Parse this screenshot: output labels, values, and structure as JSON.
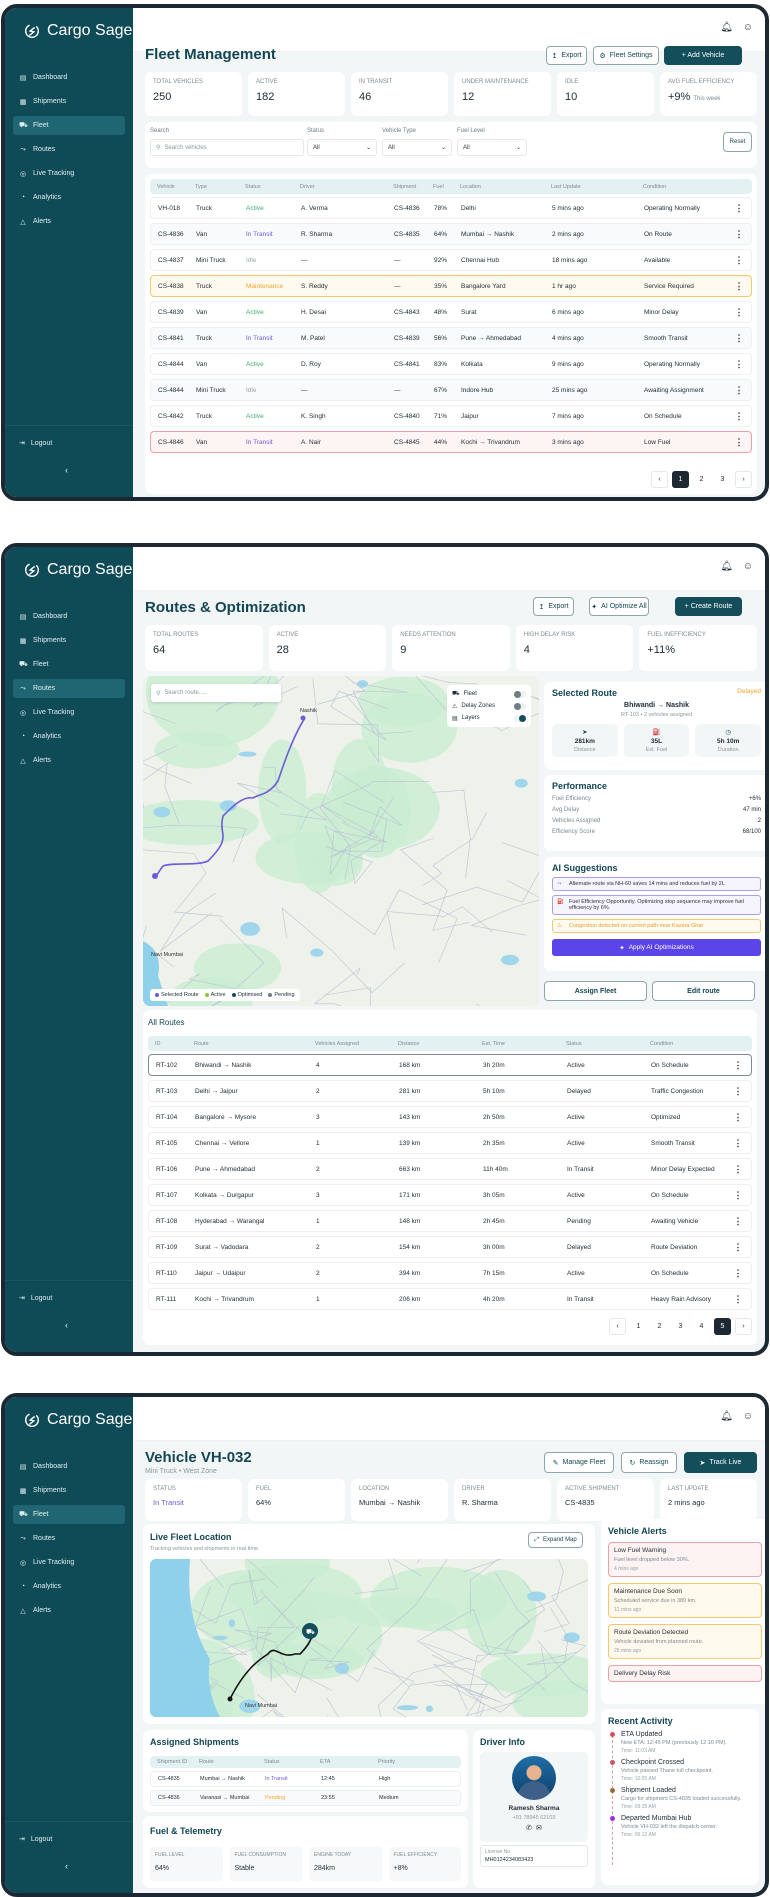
{
  "app": {
    "name": "Cargo Sage"
  },
  "sidebar": {
    "items": [
      {
        "label": "Dashboard",
        "icon": "dashboard-icon"
      },
      {
        "label": "Shipments",
        "icon": "shipments-icon"
      },
      {
        "label": "Fleet",
        "icon": "truck-icon"
      },
      {
        "label": "Routes",
        "icon": "route-icon"
      },
      {
        "label": "Live Tracking",
        "icon": "location-icon"
      },
      {
        "label": "Analytics",
        "icon": "analytics-icon"
      },
      {
        "label": "Alerts",
        "icon": "alert-icon"
      }
    ],
    "logout": "Logout"
  },
  "fleet": {
    "title": "Fleet Management",
    "buttons": {
      "export": "Export",
      "settings": "Fleet Settings",
      "add": "+ Add Vehicle"
    },
    "stats": [
      {
        "label": "Total Vehicles",
        "value": "250"
      },
      {
        "label": "Active",
        "value": "182"
      },
      {
        "label": "In Transit",
        "value": "46"
      },
      {
        "label": "Under Maintenance",
        "value": "12"
      },
      {
        "label": "Idle",
        "value": "10"
      },
      {
        "label": "Avg Fuel Efficiency",
        "value": "+9%",
        "note": "This week"
      }
    ],
    "filters": {
      "search_label": "Search",
      "search_placeholder": "Search vehicles",
      "status_label": "Status",
      "status_value": "All",
      "type_label": "Vehicle Type",
      "type_value": "All",
      "fuel_label": "Fuel Level",
      "fuel_value": "All",
      "reset": "Reset"
    },
    "columns": [
      "Vehicle",
      "Type",
      "Status",
      "Driver",
      "Shipment",
      "Fuel",
      "Location",
      "Last Update",
      "Condition"
    ],
    "rows": [
      [
        "VH-018",
        "Truck",
        "Active",
        "A. Verma",
        "CS-4836",
        "78%",
        "Delhi",
        "5 mins ago",
        "Operating Normally"
      ],
      [
        "CS-4836",
        "Van",
        "In Transit",
        "R. Sharma",
        "CS-4835",
        "64%",
        "Mumbai → Nashik",
        "2 mins ago",
        "On Route"
      ],
      [
        "CS-4837",
        "Mini Truck",
        "Idle",
        "—",
        "—",
        "92%",
        "Chennai Hub",
        "18 mins ago",
        "Available"
      ],
      [
        "CS-4838",
        "Truck",
        "Maintenance",
        "S. Reddy",
        "—",
        "35%",
        "Bangalore Yard",
        "1 hr ago",
        "Service Required"
      ],
      [
        "CS-4839",
        "Van",
        "Active",
        "H. Desai",
        "CS-4843",
        "48%",
        "Surat",
        "6 mins ago",
        "Minor Delay"
      ],
      [
        "CS-4841",
        "Truck",
        "In Transit",
        "M. Patel",
        "CS-4839",
        "56%",
        "Pune → Ahmedabad",
        "4 mins ago",
        "Smooth Transit"
      ],
      [
        "CS-4844",
        "Van",
        "Active",
        "D. Roy",
        "CS-4841",
        "83%",
        "Kolkata",
        "9 mins ago",
        "Operating Normally"
      ],
      [
        "CS-4844",
        "Mini Truck",
        "Idle",
        "—",
        "—",
        "67%",
        "Indore Hub",
        "25 mins ago",
        "Awaiting Assignment"
      ],
      [
        "CS-4842",
        "Truck",
        "Active",
        "K. Singh",
        "CS-4840",
        "71%",
        "Jaipur",
        "7 mins ago",
        "On Schedule"
      ],
      [
        "CS-4846",
        "Van",
        "In Transit",
        "A. Nair",
        "CS-4845",
        "44%",
        "Kochi → Trivandrum",
        "3 mins ago",
        "Low Fuel"
      ]
    ],
    "pages": [
      "1",
      "2",
      "3"
    ],
    "current_page": "1"
  },
  "routes": {
    "title": "Routes & Optimization",
    "buttons": {
      "export": "Export",
      "optimize": "AI Optimize All",
      "create": "+ Create Route"
    },
    "stats": [
      {
        "label": "Total Routes",
        "value": "64"
      },
      {
        "label": "Active",
        "value": "28"
      },
      {
        "label": "Needs Attention",
        "value": "9"
      },
      {
        "label": "High Delay Risk",
        "value": "4"
      },
      {
        "label": "Fuel Inefficiency",
        "value": "+11%"
      }
    ],
    "map": {
      "search_placeholder": "Search route.....",
      "layers": [
        {
          "label": "Fleet",
          "on": false
        },
        {
          "label": "Delay Zones",
          "on": false
        },
        {
          "label": "Layers",
          "on": true
        }
      ],
      "places": [
        "Nashik",
        "Navi Mumbai"
      ],
      "legend": [
        {
          "label": "Selected Route",
          "color": "#6e5bd9"
        },
        {
          "label": "Active",
          "color": "#8cc63f"
        },
        {
          "label": "Optimised",
          "color": "#134e5a"
        },
        {
          "label": "Pending",
          "color": "#6f7d83"
        }
      ]
    },
    "selected": {
      "heading": "Selected Route",
      "status": "Delayed",
      "route": "Bhiwandi → Nashik",
      "meta": "RT-103 • 2 vehicles assigned",
      "metrics": [
        {
          "value": "281km",
          "label": "Distance"
        },
        {
          "value": "35L",
          "label": "Est. Fuel"
        },
        {
          "value": "5h 10m",
          "label": "Duration"
        }
      ]
    },
    "performance": {
      "heading": "Performance",
      "items": [
        {
          "k": "Fuel Efficiency",
          "v": "+6%"
        },
        {
          "k": "Avg Delay",
          "v": "47 min"
        },
        {
          "k": "Vehicles Assigned",
          "v": "2"
        },
        {
          "k": "Efficiency Score",
          "v": "68/100"
        }
      ]
    },
    "ai": {
      "heading": "AI Suggestions",
      "items": [
        "Alternate route via NH-60 saves 14 mins and reduces fuel by 2L",
        "Fuel Efficiency Opportunity. Optimizing stop sequence may improve fuel efficiency by 6%."
      ],
      "warning": "Congestion detected on current path near Kasara Ghat",
      "apply": "Apply AI Optimizations"
    },
    "actions": {
      "assign": "Assign Fleet",
      "edit": "Edit route"
    },
    "all_title": "All Routes",
    "columns": [
      "ID",
      "Route",
      "Vehicles Assigned",
      "Distance",
      "Est. Time",
      "Status",
      "Condition"
    ],
    "rows": [
      [
        "RT-102",
        "Bhiwandi → Nashik",
        "4",
        "168 km",
        "3h 20m",
        "Active",
        "On Schedule"
      ],
      [
        "RT-103",
        "Delhi → Jaipur",
        "2",
        "281 km",
        "5h 10m",
        "Delayed",
        "Traffic Congestion"
      ],
      [
        "RT-104",
        "Bangalore → Mysore",
        "3",
        "143 km",
        "2h 50m",
        "Active",
        "Optimized"
      ],
      [
        "RT-105",
        "Chennai → Vellore",
        "1",
        "139 km",
        "2h 35m",
        "Active",
        "Smooth Transit"
      ],
      [
        "RT-106",
        "Pune → Ahmedabad",
        "2",
        "663 km",
        "11h 40m",
        "In Transit",
        "Minor Delay Expected"
      ],
      [
        "RT-107",
        "Kolkata → Durgapur",
        "3",
        "171 km",
        "3h 05m",
        "Active",
        "On Schedule"
      ],
      [
        "RT-108",
        "Hyderabad → Warangal",
        "1",
        "148 km",
        "2h 45m",
        "Pending",
        "Awaiting Vehicle"
      ],
      [
        "RT-109",
        "Surat → Vadodara",
        "2",
        "154 km",
        "3h 00m",
        "Delayed",
        "Route Deviation"
      ],
      [
        "RT-110",
        "Jaipur → Udaipur",
        "2",
        "394 km",
        "7h 15m",
        "Active",
        "On Schedule"
      ],
      [
        "RT-111",
        "Kochi → Trivandrum",
        "1",
        "206 km",
        "4h 20m",
        "In Transit",
        "Heavy Rain Advisory"
      ]
    ],
    "pages": [
      "1",
      "2",
      "3",
      "4",
      "5"
    ],
    "current_page": "5"
  },
  "vehicle": {
    "title": "Vehicle VH-032",
    "subtitle": "Mini Truck • West Zone",
    "buttons": {
      "manage": "Manage Fleet",
      "reassign": "Reassign",
      "track": "Track Live"
    },
    "stats": [
      {
        "label": "Status",
        "value": "In Transit"
      },
      {
        "label": "Fuel",
        "value": "64%"
      },
      {
        "label": "Location",
        "value": "Mumbai → Nashik"
      },
      {
        "label": "Driver",
        "value": "R. Sharma"
      },
      {
        "label": "Active Shipment",
        "value": "CS-4835"
      },
      {
        "label": "Last Update",
        "value": "2 mins ago"
      }
    ],
    "live": {
      "title": "Live Fleet Location",
      "subtitle": "Tracking vehicles and shipments in real time.",
      "expand": "Expand Map",
      "places": [
        "Navi Mumbai"
      ]
    },
    "shipments": {
      "title": "Assigned Shipments",
      "columns": [
        "Shipment ID",
        "Route",
        "Status",
        "ETA",
        "Priority"
      ],
      "rows": [
        [
          "CS-4835",
          "Mumbai → Nashik",
          "In Transit",
          "12:45",
          "High"
        ],
        [
          "CS-4836",
          "Varanasi → Mumbai",
          "Pending",
          "23:55",
          "Medium"
        ]
      ]
    },
    "fuel": {
      "title": "Fuel & Telemetry",
      "items": [
        {
          "label": "Fuel Level",
          "value": "64%"
        },
        {
          "label": "Fuel Consumption",
          "value": "Stable"
        },
        {
          "label": "Engine Today",
          "value": "284km"
        },
        {
          "label": "Fuel Efficiency",
          "value": "+8%"
        }
      ]
    },
    "driver": {
      "title": "Driver Info",
      "name": "Ramesh Sharma",
      "phone": "+91 78945 62103",
      "license_label": "License No.",
      "license": "MH0124234083423"
    },
    "alerts": {
      "title": "Vehicle Alerts",
      "items": [
        {
          "title": "Low Fuel Warning",
          "desc": "Fuel level dropped below 30%.",
          "time": "4 mins ago",
          "level": "red"
        },
        {
          "title": "Maintenance Due Soon",
          "desc": "Scheduled service due in 380 km.",
          "time": "12 mins ago",
          "level": "yellow"
        },
        {
          "title": "Route Deviation Detected",
          "desc": "Vehicle deviated from planned route.",
          "time": "26 mins ago",
          "level": "yellow"
        },
        {
          "title": "Delivery Delay Risk",
          "desc": "",
          "time": "",
          "level": "red"
        }
      ]
    },
    "activity": {
      "title": "Recent Activity",
      "items": [
        {
          "title": "ETA Updated",
          "desc": "New ETA: 12:45 PM (previously 12:10 PM).",
          "time": "Time: 11:03 AM",
          "color": "#d0525e"
        },
        {
          "title": "Checkpoint Crossed",
          "desc": "Vehicle passed Thane toll checkpoint.",
          "time": "Time: 10:05 AM",
          "color": "#d0525e"
        },
        {
          "title": "Shipment Loaded",
          "desc": "Cargo for shipment CS-4835 loaded successfully.",
          "time": "Time: 09:28 AM",
          "color": "#a0673a"
        },
        {
          "title": "Departed Mumbai Hub",
          "desc": "Vehicle VH-032 left the dispatch center.",
          "time": "Time: 09:12 AM",
          "color": "#9b30e0"
        }
      ]
    }
  },
  "colors": {
    "sidebar": "#0f4a57",
    "primary": "#134e5a",
    "active": "#3bb273",
    "transit": "#6e5bd9",
    "maintenance": "#f0a529",
    "ai": "#5b45e8"
  }
}
